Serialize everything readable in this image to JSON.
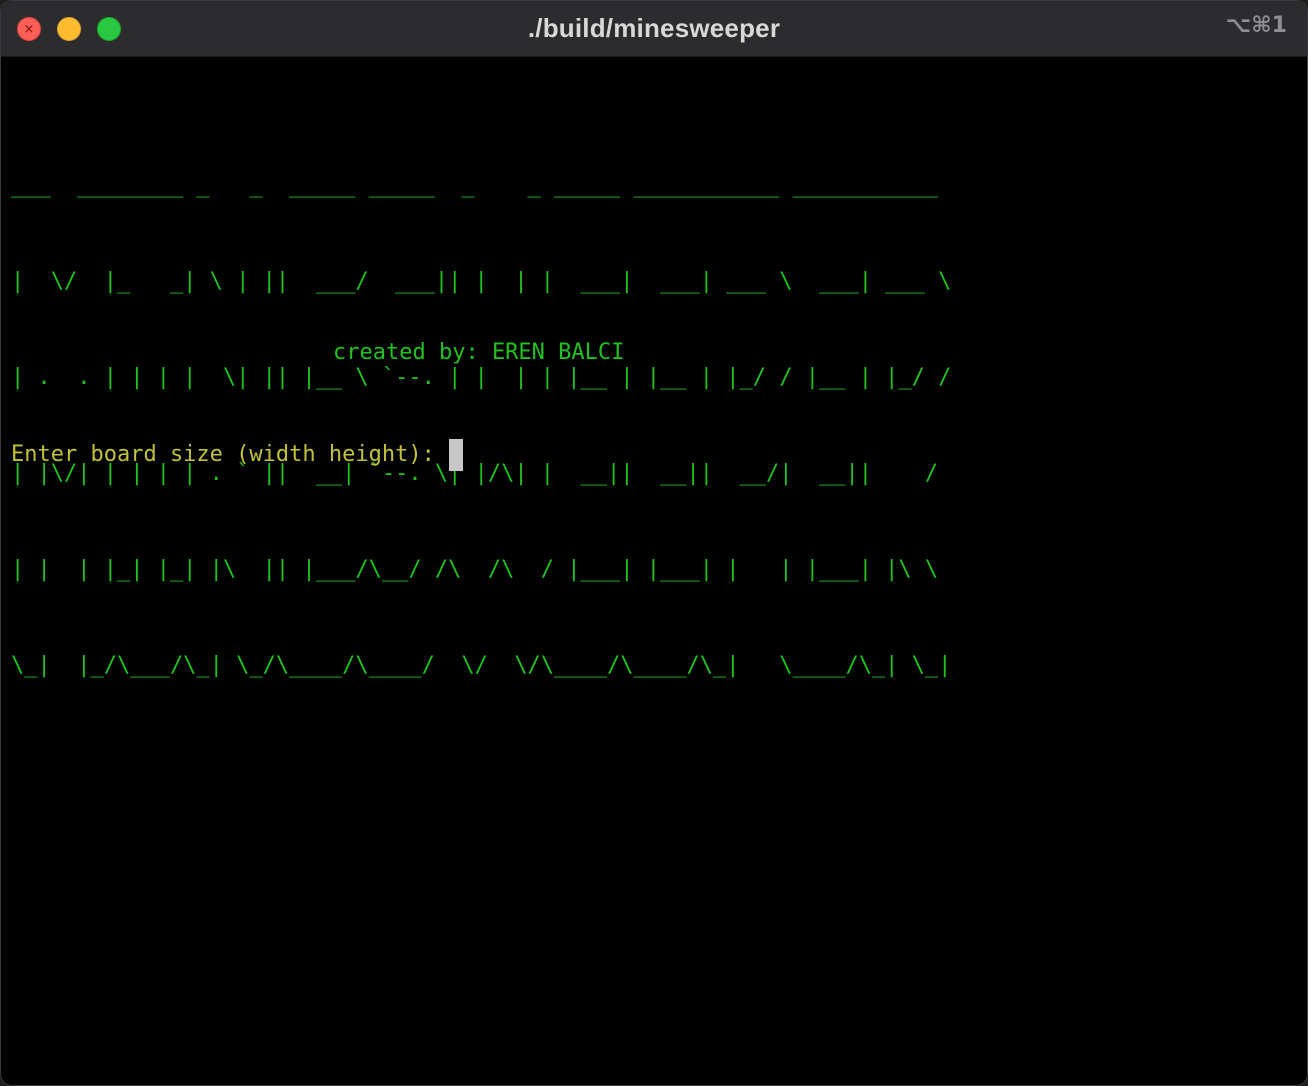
{
  "window": {
    "title": "./build/minesweeper",
    "shortcut": "⌥⌘1",
    "close_glyph": "×"
  },
  "colors": {
    "green": "#1fc21f",
    "yellow": "#c2c23a",
    "traffic_close": "#ff5f57",
    "traffic_minimize": "#febc2e",
    "traffic_zoom": "#28c840",
    "cursor": "#c7c7c7"
  },
  "terminal": {
    "banner": [
      "___  ________ _   _  _____ _____  _    _ _____ ___________ ___________",
      "|  \\/  |_   _| \\ | ||  ___/  ___|| |  | |  ___|  ___| ___ \\  ___| ___ \\",
      "| .  . | | | |  \\| || |__ \\ `--. | |  | | |__ | |__ | |_/ / |__ | |_/ /",
      "| |\\/| | | | | . ` ||  __| `--. \\| |/\\| |  __||  __||  __/|  __||    /",
      "| |  | |_| |_| |\\  || |___/\\__/ /\\  /\\  / |___| |___| |   | |___| |\\ \\",
      "\\_|  |_/\\___/\\_| \\_/\\____/\\____/  \\/  \\/\\____/\\____/\\_|   \\____/\\_| \\_|"
    ],
    "credit": "created by: EREN BALCI",
    "prompt": "Enter board size (width height):",
    "input_value": ""
  }
}
